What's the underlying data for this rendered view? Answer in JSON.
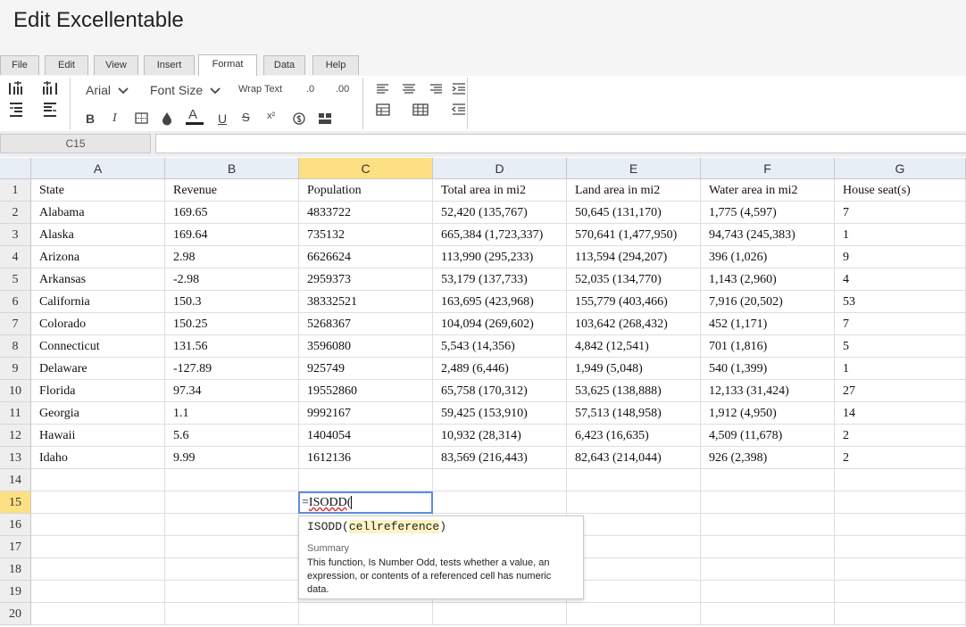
{
  "app": {
    "title": "Edit Excellentable"
  },
  "tabs": [
    {
      "label": "File",
      "active": false
    },
    {
      "label": "Edit",
      "active": false
    },
    {
      "label": "View",
      "active": false
    },
    {
      "label": "Insert",
      "active": false
    },
    {
      "label": "Format",
      "active": true
    },
    {
      "label": "Data",
      "active": false
    },
    {
      "label": "Help",
      "active": false
    }
  ],
  "ribbon": {
    "font_name": "Arial",
    "font_size": "Font Size",
    "wrap_text": "Wrap Text",
    "decimal_less": ".0",
    "decimal_more": ".00",
    "bold": "B",
    "italic": "I",
    "underline": "U",
    "strike": "S",
    "superscript": "x²",
    "font_color_letter": "A"
  },
  "formula_bar": {
    "name_box": "C15",
    "value": ""
  },
  "columns": [
    "A",
    "B",
    "C",
    "D",
    "E",
    "F",
    "G"
  ],
  "selected_column": "C",
  "selected_row": "15",
  "rows": [
    {
      "n": "1",
      "cells": [
        "State",
        "Revenue",
        "Population",
        "Total area in mi2",
        "Land area in mi2",
        "Water area in mi2",
        "House seat(s)"
      ]
    },
    {
      "n": "2",
      "cells": [
        "Alabama",
        "169.65",
        "4833722",
        "52,420 (135,767)",
        "50,645 (131,170)",
        "1,775 (4,597)",
        "7"
      ]
    },
    {
      "n": "3",
      "cells": [
        "Alaska",
        "169.64",
        "735132",
        "665,384 (1,723,337)",
        "570,641 (1,477,950)",
        "94,743 (245,383)",
        "1"
      ]
    },
    {
      "n": "4",
      "cells": [
        "Arizona",
        "2.98",
        "6626624",
        "113,990 (295,233)",
        "113,594 (294,207)",
        "396 (1,026)",
        "9"
      ]
    },
    {
      "n": "5",
      "cells": [
        "Arkansas",
        "-2.98",
        "2959373",
        "53,179 (137,733)",
        "52,035 (134,770)",
        "1,143 (2,960)",
        "4"
      ]
    },
    {
      "n": "6",
      "cells": [
        "California",
        "150.3",
        "38332521",
        "163,695 (423,968)",
        "155,779 (403,466)",
        "7,916 (20,502)",
        "53"
      ]
    },
    {
      "n": "7",
      "cells": [
        "Colorado",
        "150.25",
        "5268367",
        "104,094 (269,602)",
        "103,642 (268,432)",
        "452 (1,171)",
        "7"
      ]
    },
    {
      "n": "8",
      "cells": [
        "Connecticut",
        "131.56",
        "3596080",
        "5,543 (14,356)",
        "4,842 (12,541)",
        "701 (1,816)",
        "5"
      ]
    },
    {
      "n": "9",
      "cells": [
        "Delaware",
        "-127.89",
        "925749",
        "2,489 (6,446)",
        "1,949 (5,048)",
        "540 (1,399)",
        "1"
      ]
    },
    {
      "n": "10",
      "cells": [
        "Florida",
        "97.34",
        "19552860",
        "65,758 (170,312)",
        "53,625 (138,888)",
        "12,133 (31,424)",
        "27"
      ]
    },
    {
      "n": "11",
      "cells": [
        "Georgia",
        "1.1",
        "9992167",
        "59,425 (153,910)",
        "57,513 (148,958)",
        "1,912 (4,950)",
        "14"
      ]
    },
    {
      "n": "12",
      "cells": [
        "Hawaii",
        "5.6",
        "1404054",
        "10,932 (28,314)",
        "6,423 (16,635)",
        "4,509 (11,678)",
        "2"
      ]
    },
    {
      "n": "13",
      "cells": [
        "Idaho",
        "9.99",
        "1612136",
        "83,569 (216,443)",
        "82,643 (214,044)",
        "926 (2,398)",
        "2"
      ]
    },
    {
      "n": "14",
      "cells": [
        "",
        "",
        "",
        "",
        "",
        "",
        ""
      ]
    },
    {
      "n": "15",
      "cells": [
        "",
        "",
        "",
        "",
        "",
        "",
        ""
      ]
    },
    {
      "n": "16",
      "cells": [
        "",
        "",
        "",
        "",
        "",
        "",
        ""
      ]
    },
    {
      "n": "17",
      "cells": [
        "",
        "",
        "",
        "",
        "",
        "",
        ""
      ]
    },
    {
      "n": "18",
      "cells": [
        "",
        "",
        "",
        "",
        "",
        "",
        ""
      ]
    },
    {
      "n": "19",
      "cells": [
        "",
        "",
        "",
        "",
        "",
        "",
        ""
      ]
    },
    {
      "n": "20",
      "cells": [
        "",
        "",
        "",
        "",
        "",
        "",
        ""
      ]
    }
  ],
  "editor": {
    "prefix": "=",
    "func": "ISODD",
    "suffix": "("
  },
  "autocomplete": {
    "sig_func": "ISODD(",
    "sig_arg": "cellreference",
    "sig_close": ")",
    "summary_label": "Summary",
    "description": "This function, Is Number Odd, tests whether a value, an expression, or contents of a referenced cell has numeric data."
  },
  "colors": {
    "selected_header": "#fde083",
    "column_header": "#e8eef6",
    "editor_border": "#5b8fd8",
    "font_color_bar": "#222222"
  }
}
